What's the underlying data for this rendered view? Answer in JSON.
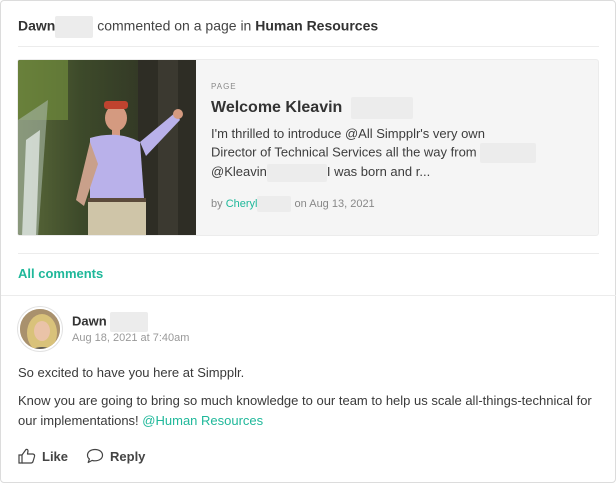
{
  "activity": {
    "actor": "Dawn",
    "verb": "commented on a page in",
    "target": "Human Resources"
  },
  "page": {
    "kicker": "PAGE",
    "title": "Welcome Kleavin",
    "excerpt_line1": "I'm thrilled to introduce @All Simpplr's very own",
    "excerpt_line2": "Director of Technical Services all the way from",
    "excerpt_line3a": "@Kleavin",
    "excerpt_line3b": "I was born and r...",
    "by": "by",
    "author": "Cheryl",
    "date": "on Aug 13, 2021",
    "image_icon": "photo-thumbnail"
  },
  "all_comments_label": "All comments",
  "comment": {
    "author": "Dawn",
    "time": "Aug 18, 2021 at 7:40am",
    "text1": "So excited to have you here at Simpplr.",
    "text2": "Know you are going to bring so much knowledge to our team to help us scale all-things-technical for our implementations!",
    "mention": "@Human Resources"
  },
  "actions": {
    "like_label": "Like",
    "reply_label": "Reply",
    "like_icon": "thumbs-up-icon",
    "reply_icon": "speech-bubble-icon"
  },
  "colors": {
    "accent": "#1fb89a",
    "text": "#3a3a3a",
    "muted": "#999999",
    "card_bg": "#f5f5f5",
    "border": "#dcdcdc"
  }
}
